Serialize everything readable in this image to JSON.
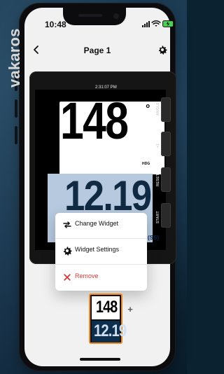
{
  "status_bar": {
    "time": "10:48",
    "icons": [
      "signal-icon",
      "wifi-icon",
      "battery-charging-icon"
    ]
  },
  "header": {
    "title": "Page 1",
    "back_icon": "back-chevron-icon",
    "settings_icon": "gear-icon"
  },
  "device_preview": {
    "brand": "vakaros",
    "clock": "2:31:07 PM",
    "heading_value": "148",
    "heading_degree": "°",
    "heading_label": "HDG",
    "speed_value": "12.19",
    "speed_unit": "(SS)",
    "side_buttons": [
      "ANGLE",
      "+1",
      "RESET",
      "START"
    ]
  },
  "context_menu": {
    "items": [
      {
        "label": "Change Widget",
        "icon": "swap-icon"
      },
      {
        "label": "Widget Settings",
        "icon": "gear-icon"
      },
      {
        "label": "Remove",
        "icon": "close-icon"
      }
    ]
  },
  "widget_selector": {
    "top_value": "148",
    "bottom_value": "12.19",
    "add_label": "+"
  },
  "colors": {
    "accent_orange": "#f08a1c",
    "danger_red": "#d53a38",
    "light_blue_panel": "#b7c9de",
    "deep_blue": "#102a44"
  }
}
